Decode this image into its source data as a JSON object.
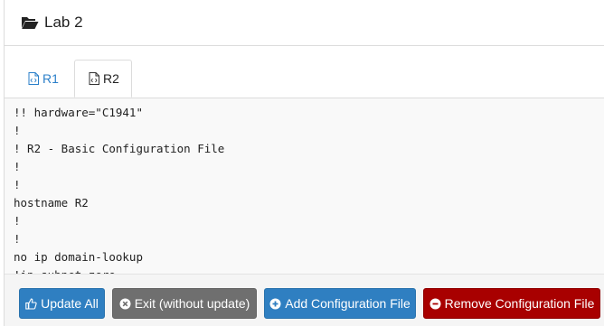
{
  "header": {
    "title": "Lab 2",
    "icon": "folder-open-icon"
  },
  "tabs": [
    {
      "label": "R1",
      "icon": "file-code-icon",
      "active": false
    },
    {
      "label": "R2",
      "icon": "file-code-icon",
      "active": true
    }
  ],
  "editor": {
    "lines": [
      "!! hardware=\"C1941\"",
      "!",
      "! R2 - Basic Configuration File",
      "!",
      "!",
      "hostname R2",
      "!",
      "!",
      "no ip domain-lookup",
      "!ip subnet-zero"
    ]
  },
  "buttons": {
    "update_all": "Update All",
    "exit": "Exit (without update)",
    "add": "Add Configuration File",
    "remove": "Remove Configuration File"
  },
  "colors": {
    "primary": "#2f7fc1",
    "secondary": "#6f6f6f",
    "danger": "#a80000",
    "tab_active_link": "#2a7fc9"
  }
}
